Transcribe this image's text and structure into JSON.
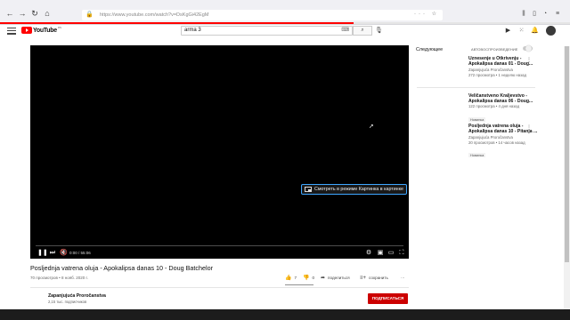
{
  "browser": {
    "url": "https://www.youtube.com/watch?v=DsKgGi42EgM"
  },
  "masthead": {
    "logo_text": "YouTube",
    "logo_sup": "RS",
    "search_query": "arma 3"
  },
  "player": {
    "pip_tooltip": "Смотреть в режиме Картинка в картинке",
    "time": "0:00 / 55:06"
  },
  "video": {
    "title": "Posljednja vatrena oluja - Apokalipsa danas 10 - Doug Batchelor",
    "meta": "70 просмотров • 8 нояб. 2020 г.",
    "likes": "7",
    "dislikes": "0",
    "share_label": "поделиться",
    "save_label": "сохранить"
  },
  "channel": {
    "name": "Zapanjujuća Proročanstva",
    "subscribers": "2,15 тыс. подписчиков",
    "subscribe_label": "ПОДПИСАТЬСЯ"
  },
  "sidebar": {
    "up_next_label": "Следующее",
    "autoplay_label": "АВТОВОСПРОИЗВЕДЕНИЕ",
    "autoplay_on": false,
    "items": [
      {
        "title": "Uznesenje u Otkrivenju - Apokalipsa danas 01 - Doug...",
        "channel": "Zapanjujuća Proročanstva",
        "stats": "272 просмотра • 1 неделю назад",
        "badge": ""
      },
      {
        "title": "Veličanstveno Kraljevstvo - Apokalipsa danas 06 - Doug...",
        "channel": "",
        "stats": "122 просмотра • 4 дня назад",
        "badge": "Новинка"
      },
      {
        "title": "Posljednja vatrena oluja - Apokalipsa danas 10 - Pitanja ...",
        "channel": "Zapanjujuća Proročanstva",
        "stats": "20 просмотров • 14 часов назад",
        "badge": "Новинка"
      }
    ]
  },
  "colors": {
    "brand_red": "#ff0000",
    "subscribe_red": "#cc0000",
    "focus_blue": "#3ea6ff"
  },
  "icons": [
    "back-icon",
    "forward-icon",
    "reload-icon",
    "home-icon",
    "lock-icon",
    "search-icon",
    "keyboard-icon",
    "mic-icon",
    "video-camera-icon",
    "apps-icon",
    "bell-icon",
    "play-icon",
    "next-icon",
    "volume-icon",
    "settings-icon",
    "miniplayer-icon",
    "theater-icon",
    "fullscreen-icon",
    "thumbs-up-icon",
    "thumbs-down-icon",
    "share-icon",
    "save-icon",
    "more-icon"
  ]
}
